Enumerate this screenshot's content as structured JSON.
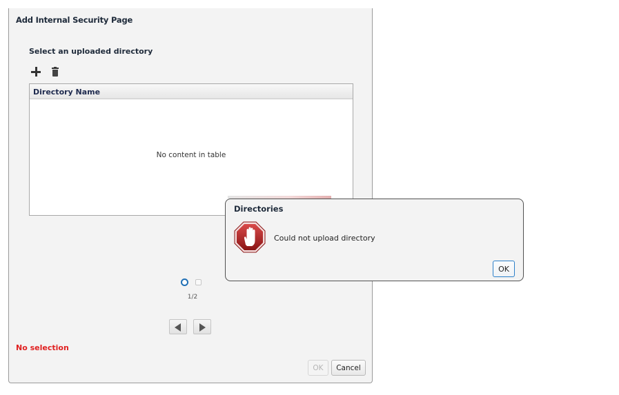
{
  "wizard": {
    "title": "Add Internal Security Page",
    "section_title": "Select an uploaded directory",
    "toolbar": {
      "add_icon": "plus-icon",
      "delete_icon": "trash-icon"
    },
    "table": {
      "columns": [
        "Directory Name"
      ],
      "rows": [],
      "empty_message": "No content in table"
    },
    "pagination": {
      "current": 1,
      "total": 2,
      "indicator": "1/2"
    },
    "status": {
      "text": "No selection",
      "color": "#e02020"
    },
    "buttons": {
      "ok": "OK",
      "cancel": "Cancel"
    }
  },
  "dialog": {
    "title": "Directories",
    "icon": "stop-hand-icon",
    "message": "Could not upload directory",
    "ok_label": "OK",
    "icon_color": "#b52222"
  }
}
